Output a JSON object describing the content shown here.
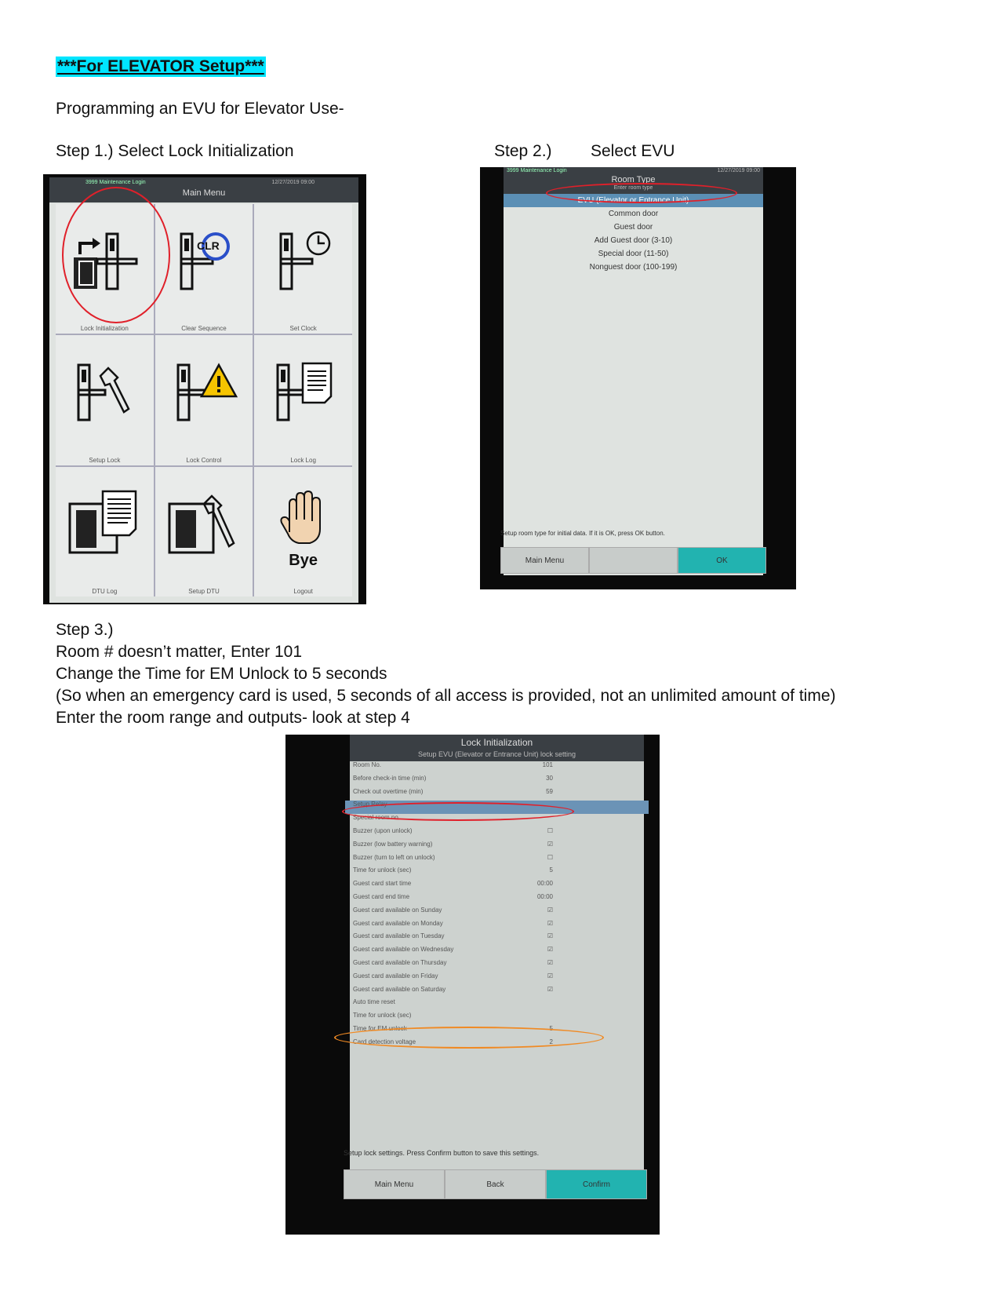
{
  "doc": {
    "title": "***For ELEVATOR Setup***",
    "subtitle": "Programming an EVU for Elevator Use-",
    "step1": "Step 1.) Select Lock Initialization",
    "step2_label": "Step 2.)",
    "step2_text": "Select EVU",
    "step3_lines": [
      "Step 3.)",
      "Room # doesn’t matter, Enter 101",
      "Change the Time for EM Unlock to 5 seconds",
      "(So when an emergency card is used, 5 seconds of all access is provided, not an unlimited amount of time)",
      "Enter the room range and outputs- look at step 4"
    ]
  },
  "screen1": {
    "status_left": "3999 Maintenance Login",
    "status_right": "12/27/2019 09:00",
    "header": "Main Menu",
    "tiles": [
      {
        "label": "Lock Initialization",
        "icon": "lock-init-icon"
      },
      {
        "label": "Clear Sequence",
        "icon": "clr-icon"
      },
      {
        "label": "Set Clock",
        "icon": "clock-icon"
      },
      {
        "label": "Setup Lock",
        "icon": "wrench-icon"
      },
      {
        "label": "Lock Control",
        "icon": "warning-icon"
      },
      {
        "label": "Lock Log",
        "icon": "document-icon"
      },
      {
        "label": "DTU Log",
        "icon": "dtu-log-icon"
      },
      {
        "label": "Setup DTU",
        "icon": "dtu-wrench-icon"
      },
      {
        "label": "Logout",
        "icon": "hand-icon",
        "text": "Bye"
      }
    ]
  },
  "screen2": {
    "status_left": "3999 Maintenance Login",
    "status_right": "12/27/2019 09:00",
    "header": "Room Type",
    "subheader": "Enter room type",
    "options": [
      "EVU (Elevator or Entrance Unit)",
      "Common door",
      "Guest door",
      "Add Guest door (3-10)",
      "Special door (11-50)",
      "Nonguest door (100-199)"
    ],
    "selected_index": 0,
    "help": "Setup room type for initial data. If it is OK, press OK button.",
    "buttons": {
      "main_menu": "Main Menu",
      "ok": "OK"
    }
  },
  "screen3": {
    "header": "Lock Initialization",
    "subheader": "Setup EVU (Elevator or Entrance Unit) lock setting",
    "rows": [
      {
        "label": "Room No.",
        "value": "101"
      },
      {
        "label": "Before check-in time (min)",
        "value": "30"
      },
      {
        "label": "Check out overtime (min)",
        "value": "59"
      },
      {
        "label": "Setup Relay",
        "value": "",
        "highlight": true
      },
      {
        "label": "Special room no.",
        "value": ""
      },
      {
        "label": "Buzzer (upon unlock)",
        "value": "☐"
      },
      {
        "label": "Buzzer (low battery warning)",
        "value": "☑"
      },
      {
        "label": "Buzzer (turn to left on unlock)",
        "value": "☐"
      },
      {
        "label": "Time for unlock (sec)",
        "value": "5"
      },
      {
        "label": "Guest card start time",
        "value": "00:00"
      },
      {
        "label": "Guest card end time",
        "value": "00:00"
      },
      {
        "label": "Guest card available on Sunday",
        "value": "☑"
      },
      {
        "label": "Guest card available on Monday",
        "value": "☑"
      },
      {
        "label": "Guest card available on Tuesday",
        "value": "☑"
      },
      {
        "label": "Guest card available on Wednesday",
        "value": "☑"
      },
      {
        "label": "Guest card available on Thursday",
        "value": "☑"
      },
      {
        "label": "Guest card available on Friday",
        "value": "☑"
      },
      {
        "label": "Guest card available on Saturday",
        "value": "☑"
      },
      {
        "label": "Auto time reset",
        "value": ""
      },
      {
        "label": "Time for unlock (sec)",
        "value": ""
      },
      {
        "label": "Time for EM unlock",
        "value": "5"
      },
      {
        "label": "Card detection voltage",
        "value": "2"
      }
    ],
    "help": "Setup lock settings. Press Confirm button to save this settings.",
    "buttons": {
      "main_menu": "Main Menu",
      "back": "Back",
      "confirm": "Confirm"
    }
  },
  "colors": {
    "highlight": "#00e5ff",
    "annotation_red": "#e0202a",
    "annotation_orange": "#f08a24",
    "teal_button": "#22b3b0"
  }
}
